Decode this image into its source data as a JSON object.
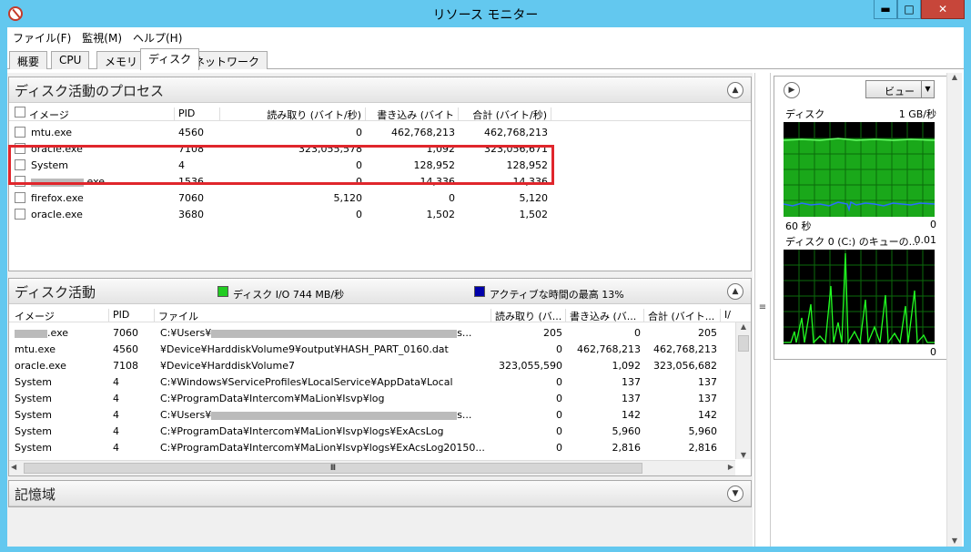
{
  "window": {
    "title": "リソース モニター",
    "min": "▬",
    "max": "□",
    "close": "✕"
  },
  "menu": [
    "ファイル(F)",
    "監視(M)",
    "ヘルプ(H)"
  ],
  "tabs": [
    "概要",
    "CPU",
    "メモリ",
    "ディスク",
    "ネットワーク"
  ],
  "process_panel": {
    "title": "ディスク活動のプロセス",
    "headers": {
      "image": "イメージ",
      "pid": "PID",
      "read": "読み取り (バイト/秒)",
      "write": "書き込み (バイト",
      "total": "合計 (バイト/秒)"
    },
    "rows": [
      {
        "image": "mtu.exe",
        "pid": "4560",
        "read": "0",
        "write": "462,768,213",
        "total": "462,768,213"
      },
      {
        "image": "oracle.exe",
        "pid": "7108",
        "read": "323,055,578",
        "write": "1,092",
        "total": "323,056,671"
      },
      {
        "image": "System",
        "pid": "4",
        "read": "0",
        "write": "128,952",
        "total": "128,952"
      },
      {
        "image": ".exe",
        "pid": "1536",
        "read": "0",
        "write": "14,336",
        "total": "14,336"
      },
      {
        "image": "firefox.exe",
        "pid": "7060",
        "read": "5,120",
        "write": "0",
        "total": "5,120"
      },
      {
        "image": "oracle.exe",
        "pid": "3680",
        "read": "0",
        "write": "1,502",
        "total": "1,502"
      }
    ]
  },
  "activity_panel": {
    "title": "ディスク活動",
    "legend1": "ディスク I/O 744 MB/秒",
    "legend1_color": "#22cc22",
    "legend2": "アクティブな時間の最高 13%",
    "legend2_color": "#0000aa",
    "headers": {
      "image": "イメージ",
      "pid": "PID",
      "file": "ファイル",
      "read": "読み取り (バ...",
      "write": "書き込み (バ...",
      "total": "合計 (バイト...",
      "io": "I/"
    },
    "rows": [
      {
        "image": ".exe",
        "pid": "7060",
        "file": "C:¥Users¥",
        "file_tail": "s...",
        "read": "205",
        "write": "0",
        "total": "205"
      },
      {
        "image": "mtu.exe",
        "pid": "4560",
        "file": "¥Device¥HarddiskVolume9¥output¥HASH_PART_0160.dat",
        "file_tail": "",
        "read": "0",
        "write": "462,768,213",
        "total": "462,768,213"
      },
      {
        "image": "oracle.exe",
        "pid": "7108",
        "file": "¥Device¥HarddiskVolume7",
        "file_tail": "",
        "read": "323,055,590",
        "write": "1,092",
        "total": "323,056,682"
      },
      {
        "image": "System",
        "pid": "4",
        "file": "C:¥Windows¥ServiceProfiles¥LocalService¥AppData¥Local",
        "file_tail": "",
        "read": "0",
        "write": "137",
        "total": "137"
      },
      {
        "image": "System",
        "pid": "4",
        "file": "C:¥ProgramData¥Intercom¥MaLion¥Isvp¥log",
        "file_tail": "",
        "read": "0",
        "write": "137",
        "total": "137"
      },
      {
        "image": "System",
        "pid": "4",
        "file": "C:¥Users¥",
        "file_tail": "s...",
        "read": "0",
        "write": "142",
        "total": "142"
      },
      {
        "image": "System",
        "pid": "4",
        "file": "C:¥ProgramData¥Intercom¥MaLion¥Isvp¥logs¥ExAcsLog",
        "file_tail": "",
        "read": "0",
        "write": "5,960",
        "total": "5,960"
      },
      {
        "image": "System",
        "pid": "4",
        "file": "C:¥ProgramData¥Intercom¥MaLion¥Isvp¥logs¥ExAcsLog20150...",
        "file_tail": "",
        "read": "0",
        "write": "2,816",
        "total": "2,816"
      }
    ]
  },
  "storage_panel": {
    "title": "記憶域"
  },
  "right": {
    "view_label": "ビュー",
    "disk_label": "ディスク",
    "disk_scale": "1 GB/秒",
    "time_label": "60 秒",
    "zero": "0",
    "queue_label": "ディスク 0 (C:) のキューの...",
    "queue_value": "0.01",
    "zero2": "0"
  },
  "scroll_mark": "Ⅲ"
}
